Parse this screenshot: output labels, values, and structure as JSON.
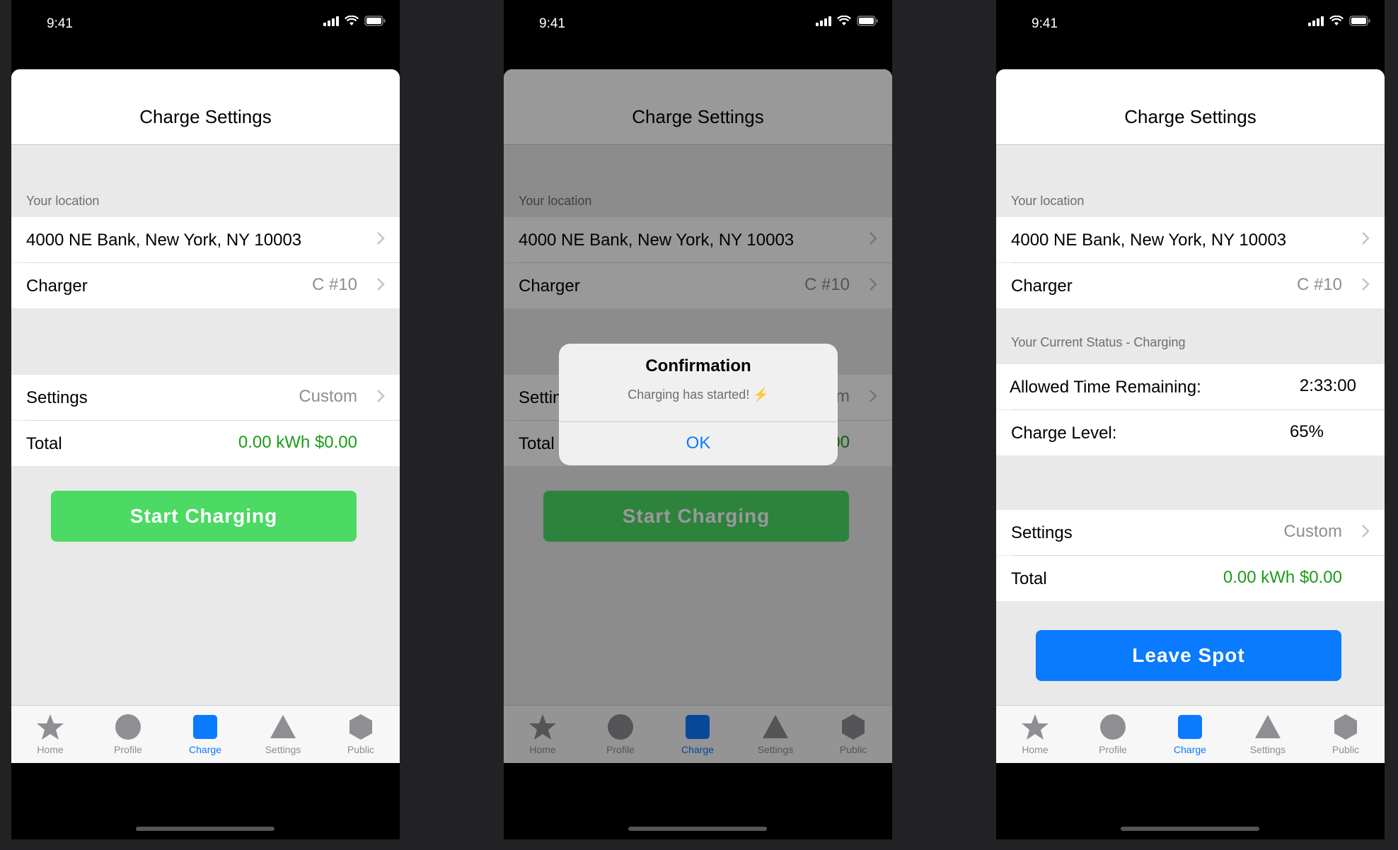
{
  "status": {
    "time": "9:41"
  },
  "nav": {
    "title": "Charge Settings"
  },
  "location": {
    "section_label": "Your location",
    "address": "4000 NE Bank, New York, NY 10003"
  },
  "charger": {
    "label": "Charger",
    "value": "C #10"
  },
  "settings": {
    "label": "Settings",
    "value": "Custom"
  },
  "total": {
    "label": "Total",
    "value": "0.00 kWh $0.00"
  },
  "start_button": "Start Charging",
  "leave_button": "Leave Spot",
  "status_section": {
    "label": "Your Current Status - Charging"
  },
  "allowed_time": {
    "label": "Allowed Time Remaining:",
    "value": "2:33:00"
  },
  "charge_level": {
    "label": "Charge Level:",
    "value": "65%"
  },
  "alert": {
    "title": "Confirmation",
    "message": "Charging has started!",
    "icon": "⚡",
    "ok": "OK"
  },
  "tabs": [
    {
      "label": "Home",
      "icon": "star-icon"
    },
    {
      "label": "Profile",
      "icon": "circle-icon"
    },
    {
      "label": "Charge",
      "icon": "square-icon"
    },
    {
      "label": "Settings",
      "icon": "triangle-icon"
    },
    {
      "label": "Public",
      "icon": "hexagon-icon"
    }
  ],
  "colors": {
    "accent": "#0a7aff",
    "green_button": "#4cd964",
    "green_text": "#1a9c1a",
    "tab_inactive": "#8e8e93"
  }
}
